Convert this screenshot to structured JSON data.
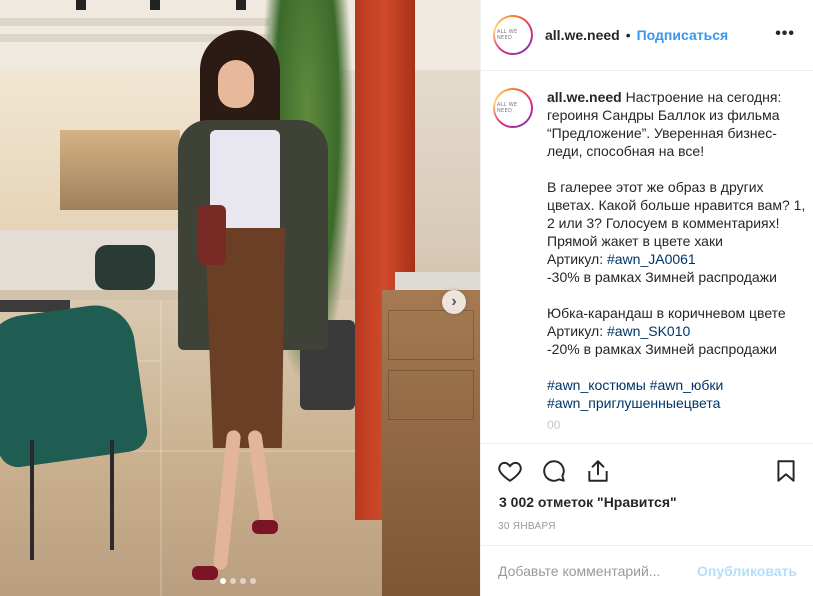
{
  "post": {
    "avatar_text": "ALL WE NEED",
    "username": "all.we.need",
    "separator": "•",
    "follow_label": "Подписаться",
    "more_label": "•••",
    "next_label": "›",
    "slide_count": 4,
    "active_slide": 1
  },
  "caption": {
    "username": "all.we.need",
    "p1": " Настроение на сегодня: героиня Сандры Баллок из фильма “Предложение”. Уверенная бизнес-леди, способная на все!",
    "p2": "В галерее этот же образ в других цветах. Какой больше нравится вам? 1, 2 или 3? Голосуем в комментариях!",
    "p3": "Прямой жакет в цвете хаки",
    "article_label": "Артикул: ",
    "tag1": "#awn_JA0061",
    "p4": "-30% в рамках Зимней распродажи",
    "p5": "Юбка-карандаш в коричневом цвете",
    "tag2": "#awn_SK010",
    "p6": "-20% в рамках Зимней распродажи",
    "tag3": "#awn_костюмы",
    "tag4": "#awn_юбки",
    "tag5": "#awn_приглушенныецвета",
    "faded": "00"
  },
  "meta": {
    "likes": "3 002 отметок \"Нравится\"",
    "date": "30 января"
  },
  "comment_box": {
    "placeholder": "Добавьте комментарий...",
    "publish_label": "Опубликовать"
  }
}
